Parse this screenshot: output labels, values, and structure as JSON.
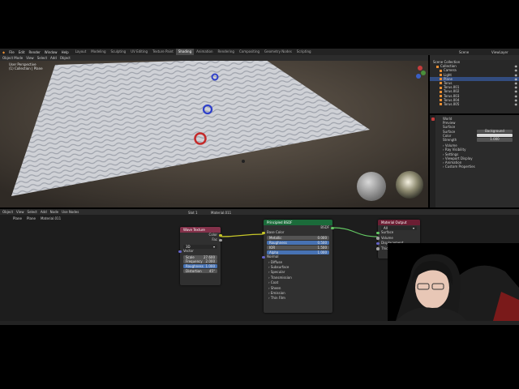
{
  "topbar": {
    "menu": [
      "File",
      "Edit",
      "Render",
      "Window",
      "Help"
    ],
    "workspaces": [
      "Layout",
      "Modeling",
      "Sculpting",
      "UV Editing",
      "Texture Paint",
      "Shading",
      "Animation",
      "Rendering",
      "Compositing",
      "Geometry Nodes",
      "Scripting"
    ],
    "active_workspace": "Shading",
    "scene": "Scene",
    "view_layer": "ViewLayer"
  },
  "viewport": {
    "header": [
      "Object Mode",
      "View",
      "Select",
      "Add",
      "Object"
    ],
    "info": [
      "User Perspective",
      "(1) Collection | Plane"
    ]
  },
  "outliner": {
    "root": "Scene Collection",
    "items": [
      {
        "label": "Collection",
        "selected": false
      },
      {
        "label": "Camera",
        "selected": false
      },
      {
        "label": "Light",
        "selected": false
      },
      {
        "label": "Plane",
        "selected": true
      },
      {
        "label": "Torus",
        "selected": false
      },
      {
        "label": "Torus.001",
        "selected": false
      },
      {
        "label": "Torus.002",
        "selected": false
      },
      {
        "label": "Torus.003",
        "selected": false
      },
      {
        "label": "Torus.004",
        "selected": false
      },
      {
        "label": "Torus.005",
        "selected": false
      }
    ]
  },
  "properties": {
    "world": "World",
    "sections": [
      "Preview",
      "Surface"
    ],
    "surface_label": "Surface",
    "surface_value": "Background",
    "color_label": "Color",
    "strength_label": "Strength",
    "strength_value": "1.000",
    "collapsed": [
      "Volume",
      "Ray Visibility",
      "Settings",
      "Viewport Display",
      "Animation",
      "Custom Properties"
    ]
  },
  "node_editor": {
    "header": [
      "Object",
      "View",
      "Select",
      "Add",
      "Node",
      "Use Nodes"
    ],
    "slot": "Slot 1",
    "material": "Material.011",
    "breadcrumb": [
      "Plane",
      "Plane",
      "Material.011"
    ]
  },
  "wave_node": {
    "title": "Wave Texture",
    "outputs": [
      "Color",
      "Fac"
    ],
    "dimension": "3D",
    "vector": "Vector",
    "fields": [
      {
        "label": "Scale",
        "value": "27.600",
        "highlight": false
      },
      {
        "label": "Frequency",
        "value": "2.000",
        "highlight": false
      },
      {
        "label": "Roughness",
        "value": "1.000",
        "highlight": true
      },
      {
        "label": "Distortion",
        "value": "45°",
        "highlight": false
      }
    ]
  },
  "bsdf_node": {
    "title": "Principled BSDF",
    "output": "BSDF",
    "base_color": "Base Color",
    "fields": [
      {
        "label": "Metallic",
        "value": "0.000",
        "highlight": false
      },
      {
        "label": "Roughness",
        "value": "0.500",
        "highlight": true
      },
      {
        "label": "IOR",
        "value": "1.500",
        "highlight": false
      },
      {
        "label": "Alpha",
        "value": "1.000",
        "highlight": true
      }
    ],
    "normal": "Normal",
    "panels": [
      "Diffuse",
      "Subsurface",
      "Specular",
      "Transmission",
      "Coat",
      "Sheen",
      "Emission",
      "Thin Film"
    ]
  },
  "output_node": {
    "title": "Material Output",
    "target": "All",
    "inputs": [
      "Surface",
      "Volume",
      "Displacement",
      "Thickness"
    ]
  },
  "colors": {
    "texture_header": "#83314a",
    "shader_header": "#1b6b3a",
    "output_header": "#6b1e33",
    "selection": "#334d80",
    "accent_blue": "#4772b3"
  }
}
